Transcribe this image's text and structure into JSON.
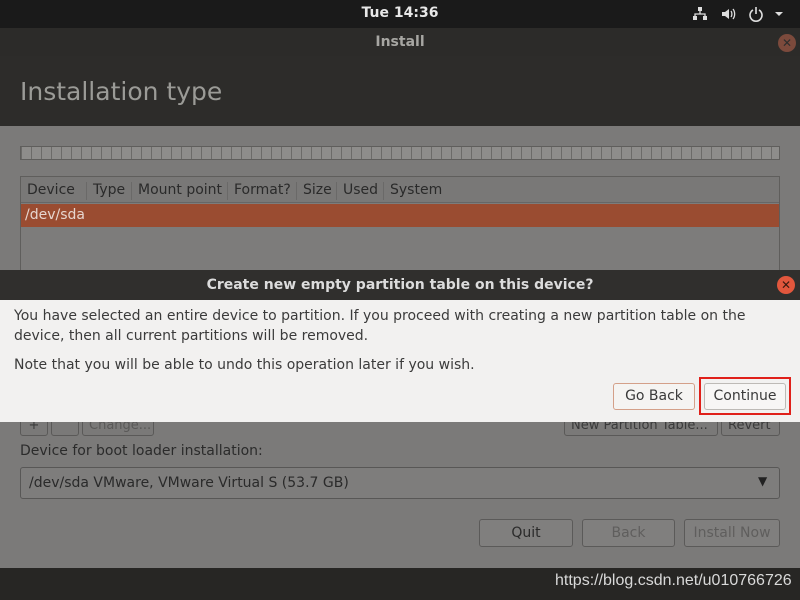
{
  "topbar": {
    "clock": "Tue 14:36",
    "icons": [
      "network-icon",
      "volume-icon",
      "power-icon",
      "menu-arrow-icon"
    ]
  },
  "window": {
    "title": "Install",
    "heading": "Installation type"
  },
  "partition_table": {
    "columns": [
      "Device",
      "Type",
      "Mount point",
      "Format?",
      "Size",
      "Used",
      "System"
    ],
    "rows": [
      {
        "device": "/dev/sda"
      }
    ],
    "selected_row_color": "#9a4c31"
  },
  "partition_buttons": {
    "add": "+",
    "remove": "-",
    "change": "Change...",
    "new_table": "New Partition Table...",
    "revert": "Revert"
  },
  "bootloader": {
    "label": "Device for boot loader installation:",
    "selected": "/dev/sda VMware, VMware Virtual S (53.7 GB)"
  },
  "nav": {
    "quit": "Quit",
    "back": "Back",
    "install_now": "Install Now"
  },
  "dialog": {
    "title": "Create new empty partition table on this device?",
    "message": "You have selected an entire device to partition. If you proceed with creating a new partition table on the device, then all current partitions will be removed.",
    "note": "Note that you will be able to undo this operation later if you wish.",
    "go_back": "Go Back",
    "continue": "Continue",
    "highlight_color": "#e0201a"
  },
  "watermark": "https://blog.csdn.net/u010766726"
}
